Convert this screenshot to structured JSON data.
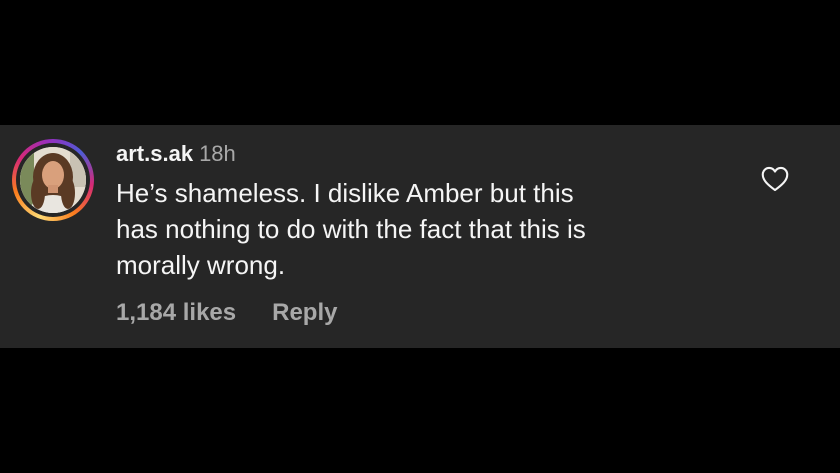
{
  "comment": {
    "username": "art.s.ak",
    "timestamp": "18h",
    "text_lines": [
      "He’s shameless. I dislike Amber but this",
      "has nothing to do with the fact that this is",
      "morally wrong."
    ],
    "likes": "1,184 likes",
    "reply_label": "Reply",
    "avatar_icon": "profile-photo-avatar",
    "like_icon": "heart-outline-icon"
  },
  "colors": {
    "background": "#000000",
    "card": "#262626",
    "primary_text": "#f5f5f5",
    "secondary_text": "#a8a8a8"
  }
}
